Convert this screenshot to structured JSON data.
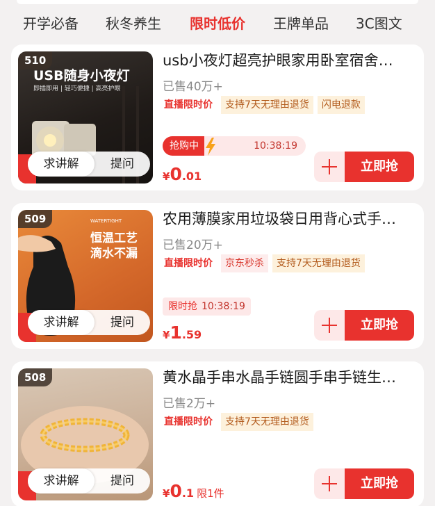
{
  "tabs": [
    "开学必备",
    "秋冬养生",
    "限时低价",
    "王牌单品",
    "3C图文"
  ],
  "active_tab_index": 2,
  "products": [
    {
      "rank": "510",
      "image_caption": "USB随身小夜灯",
      "image_subcaption": "即插即用 | 轻巧便捷 | 高亮护眼",
      "title": "usb小夜灯超亮护眼家用卧室宿舍…",
      "sold": "已售40万+",
      "tags": [
        "直播限时价",
        "支持7天无理由退货",
        "闪电退款"
      ],
      "timer_label": "抢购中",
      "timer": "10:38:19",
      "price": {
        "symbol": "¥",
        "int": "0",
        "dec": ".01",
        "note": ""
      },
      "ask_label": "求讲解",
      "question_label": "提问",
      "buy_label": "立即抢"
    },
    {
      "rank": "509",
      "image_caption": "恒温工艺\n滴水不漏",
      "image_subcaption": "WATERTIGHT",
      "title": "农用薄膜家用垃圾袋日用背心式手…",
      "sold": "已售20万+",
      "tags": [
        "直播限时价",
        "京东秒杀",
        "支持7天无理由退货"
      ],
      "timer_label": "限时抢",
      "timer": "10:38:19",
      "price": {
        "symbol": "¥",
        "int": "1",
        "dec": ".59",
        "note": ""
      },
      "ask_label": "求讲解",
      "question_label": "提问",
      "buy_label": "立即抢"
    },
    {
      "rank": "508",
      "image_caption": "",
      "image_subcaption": "",
      "title": "黄水晶手串水晶手链圆手串手链生…",
      "sold": "已售2万+",
      "tags": [
        "直播限时价",
        "支持7天无理由退货"
      ],
      "timer_label": "",
      "timer": "",
      "price": {
        "symbol": "¥",
        "int": "0",
        "dec": ".1",
        "note": "限1件"
      },
      "ask_label": "求讲解",
      "question_label": "提问",
      "buy_label": "立即抢"
    }
  ],
  "colors": {
    "accent": "#e8322e",
    "bg": "#f3f1f1"
  }
}
